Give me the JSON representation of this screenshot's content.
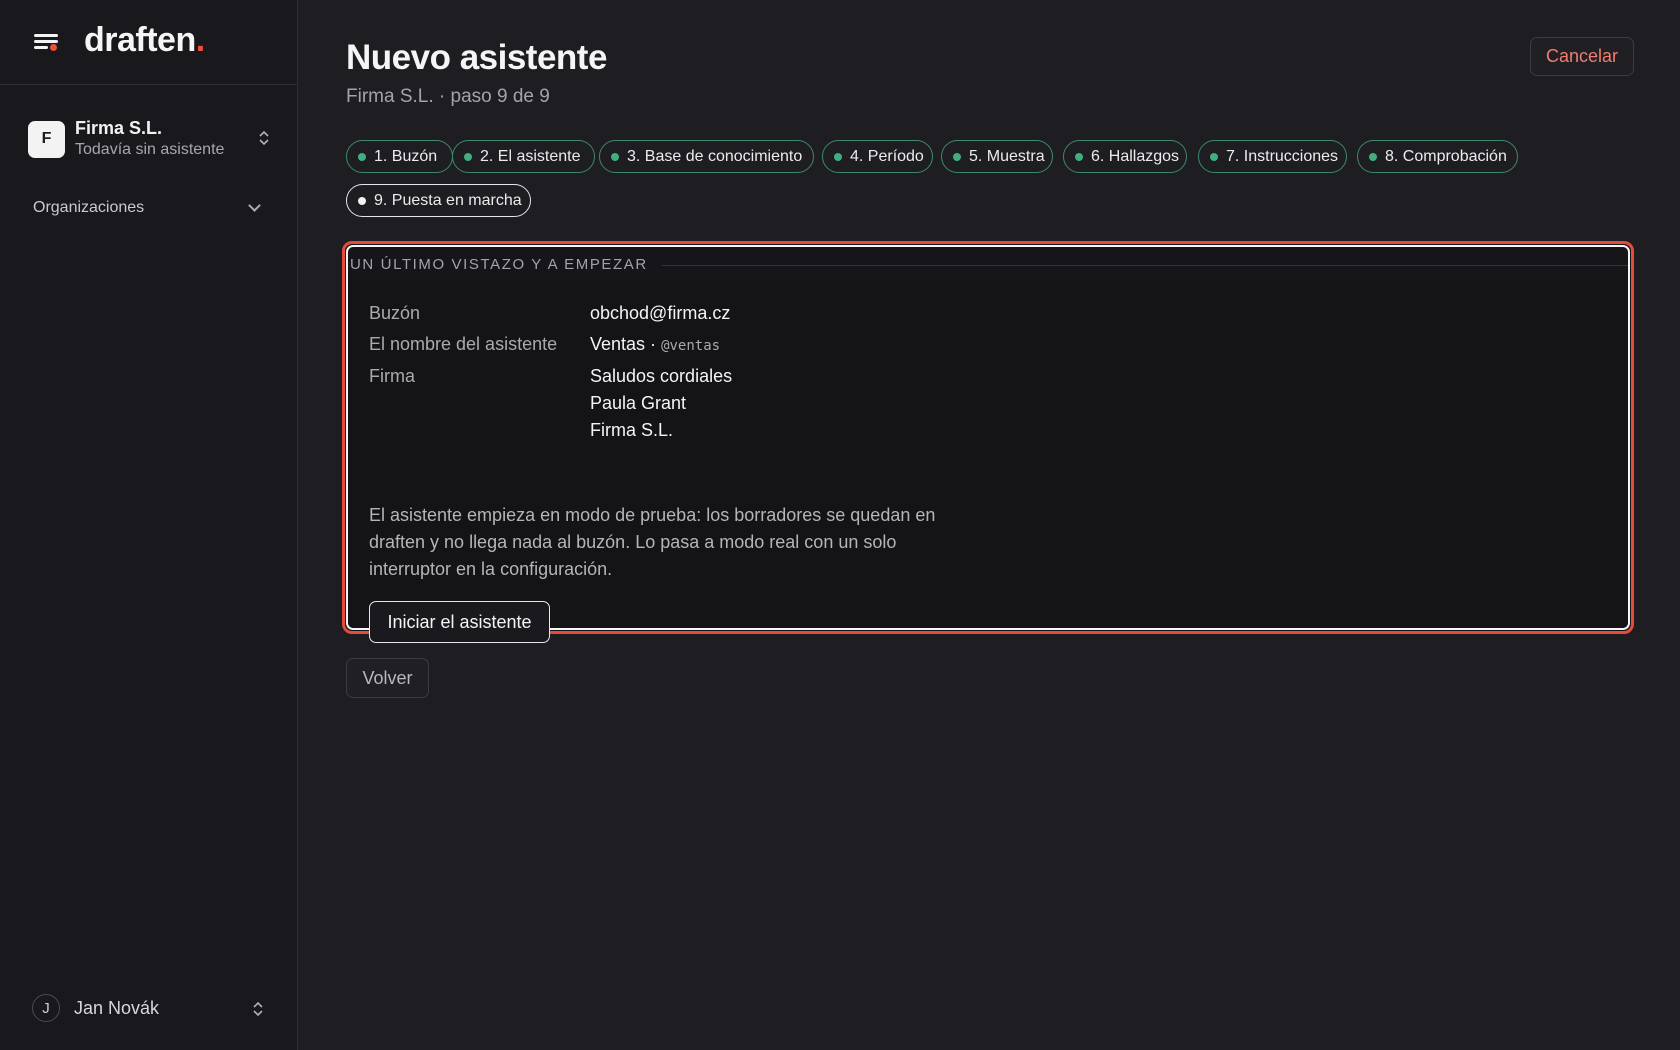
{
  "app": {
    "logo_text": "draften",
    "logo_dot": "."
  },
  "org": {
    "initial": "F",
    "name": "Firma S.L.",
    "status": "Todavía sin asistente"
  },
  "sidebar": {
    "organizations_label": "Organizaciones"
  },
  "user": {
    "initial": "J",
    "name": "Jan Novák"
  },
  "page": {
    "title": "Nuevo asistente",
    "subtitle": "Firma S.L. · paso 9 de 9",
    "cancel_label": "Cancelar"
  },
  "steps": [
    {
      "label": "1. Buzón",
      "state": "done"
    },
    {
      "label": "2. El asistente",
      "state": "done"
    },
    {
      "label": "3. Base de conocimiento",
      "state": "done"
    },
    {
      "label": "4. Período",
      "state": "done"
    },
    {
      "label": "5. Muestra",
      "state": "done"
    },
    {
      "label": "6. Hallazgos",
      "state": "done"
    },
    {
      "label": "7. Instrucciones",
      "state": "done"
    },
    {
      "label": "8. Comprobación",
      "state": "done"
    },
    {
      "label": "9. Puesta en marcha",
      "state": "current"
    }
  ],
  "summary": {
    "heading": "UN ÚLTIMO VISTAZO Y A EMPEZAR",
    "rows": {
      "mailbox": {
        "key": "Buzón",
        "value": "obchod@firma.cz"
      },
      "assistant_name": {
        "key": "El nombre del asistente",
        "value": "Ventas ·",
        "handle": "@ventas"
      },
      "signature": {
        "key": "Firma",
        "lines": [
          "Saludos cordiales",
          "Paula Grant",
          "Firma S.L."
        ]
      }
    },
    "note": "El asistente empieza en modo de prueba: los borradores se quedan en draften y no llega nada al buzón. Lo pasa a modo real con un solo interruptor en la configuración.",
    "start_label": "Iniciar el asistente"
  },
  "footer": {
    "back_label": "Volver"
  },
  "colors": {
    "accent": "#f04e3e",
    "step_done": "#3fae80",
    "background": "#1d1d22",
    "sidebar": "#19191d"
  }
}
